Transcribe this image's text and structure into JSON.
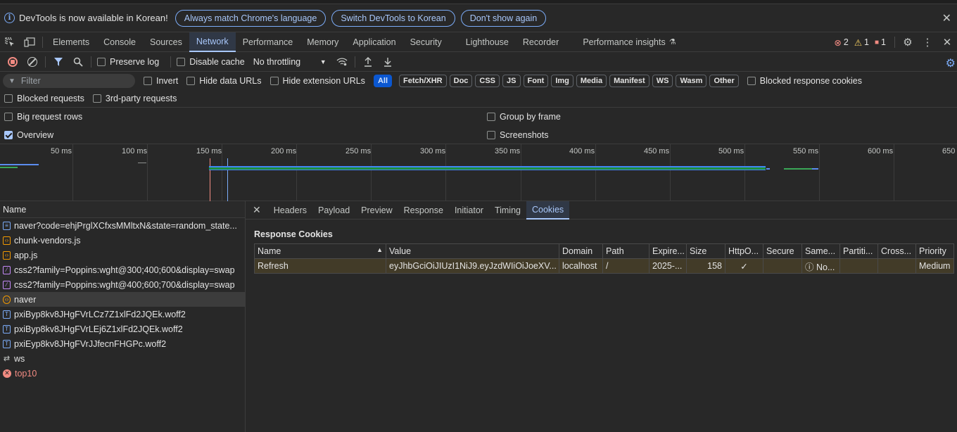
{
  "infobar": {
    "text": "DevTools is now available in Korean!",
    "buttons": [
      "Always match Chrome's language",
      "Switch DevTools to Korean",
      "Don't show again"
    ]
  },
  "tabs": [
    "Elements",
    "Console",
    "Sources",
    "Network",
    "Performance",
    "Memory",
    "Application",
    "Security",
    "Lighthouse",
    "Recorder",
    "Performance insights"
  ],
  "active_tab": "Network",
  "status": {
    "errors": "2",
    "warnings": "1",
    "issues": "1"
  },
  "toolbar": {
    "preserve_log": "Preserve log",
    "disable_cache": "Disable cache",
    "throttling": "No throttling"
  },
  "filter": {
    "placeholder": "Filter",
    "invert": "Invert",
    "hide_data_urls": "Hide data URLs",
    "hide_extension_urls": "Hide extension URLs",
    "types": [
      "All",
      "Fetch/XHR",
      "Doc",
      "CSS",
      "JS",
      "Font",
      "Img",
      "Media",
      "Manifest",
      "WS",
      "Wasm",
      "Other"
    ],
    "blocked_response_cookies": "Blocked response cookies",
    "blocked_requests": "Blocked requests",
    "third_party": "3rd-party requests"
  },
  "settings": {
    "big_rows": "Big request rows",
    "overview": "Overview",
    "group_by_frame": "Group by frame",
    "screenshots": "Screenshots"
  },
  "timeline_ticks": [
    "50 ms",
    "100 ms",
    "150 ms",
    "200 ms",
    "250 ms",
    "300 ms",
    "350 ms",
    "400 ms",
    "450 ms",
    "500 ms",
    "550 ms",
    "600 ms",
    "650"
  ],
  "requests": {
    "header": "Name",
    "items": [
      {
        "name": "naver?code=ehjPrglXCfxsMMltxN&state=random_state...",
        "type": "doc"
      },
      {
        "name": "chunk-vendors.js",
        "type": "js"
      },
      {
        "name": "app.js",
        "type": "js"
      },
      {
        "name": "css2?family=Poppins:wght@300;400;600&display=swap",
        "type": "css"
      },
      {
        "name": "css2?family=Poppins:wght@400;600;700&display=swap",
        "type": "css"
      },
      {
        "name": "naver",
        "type": "xhr"
      },
      {
        "name": "pxiByp8kv8JHgFVrLCz7Z1xlFd2JQEk.woff2",
        "type": "font"
      },
      {
        "name": "pxiByp8kv8JHgFVrLEj6Z1xlFd2JQEk.woff2",
        "type": "font"
      },
      {
        "name": "pxiEyp8kv8JHgFVrJJfecnFHGPc.woff2",
        "type": "font"
      },
      {
        "name": "ws",
        "type": "ws"
      },
      {
        "name": "top10",
        "type": "error"
      }
    ]
  },
  "detail_tabs": [
    "Headers",
    "Payload",
    "Preview",
    "Response",
    "Initiator",
    "Timing",
    "Cookies"
  ],
  "active_detail_tab": "Cookies",
  "cookies": {
    "title": "Response Cookies",
    "columns": [
      "Name",
      "Value",
      "Domain",
      "Path",
      "Expire...",
      "Size",
      "HttpO...",
      "Secure",
      "Same...",
      "Partiti...",
      "Cross...",
      "Priority"
    ],
    "rows": [
      [
        "Refresh",
        "eyJhbGciOiJIUzI1NiJ9.eyJzdWIiOiJoeXV...",
        "localhost",
        "/",
        "2025-...",
        "158",
        "✓",
        "",
        "ⓘ No...",
        "",
        "",
        "Medium"
      ]
    ]
  }
}
